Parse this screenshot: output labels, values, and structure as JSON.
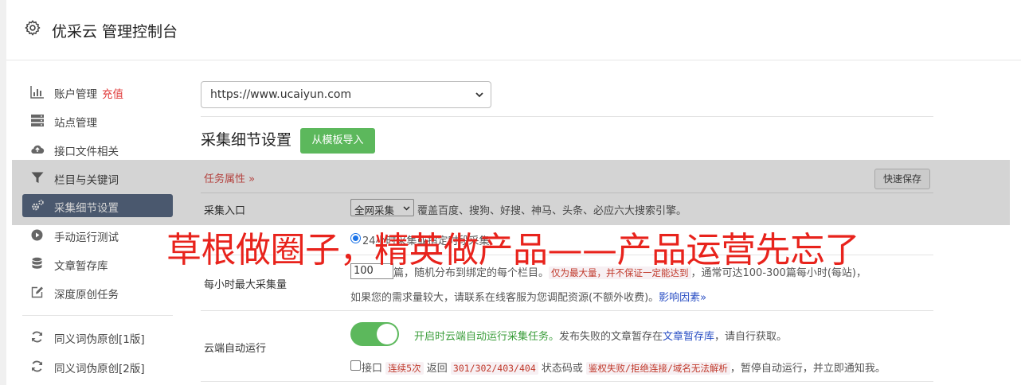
{
  "header": {
    "title": "优采云 管理控制台"
  },
  "sidebar": {
    "items": [
      {
        "label": "账户管理",
        "extra": "充值",
        "icon": "bar-chart-icon"
      },
      {
        "label": "站点管理",
        "icon": "server-icon"
      },
      {
        "label": "接口文件相关",
        "icon": "cloud-upload-icon"
      },
      {
        "label": "栏目与关键词",
        "icon": "filter-icon"
      },
      {
        "label": "采集细节设置",
        "icon": "gears-icon",
        "active": true
      },
      {
        "label": "手动运行测试",
        "icon": "play-circle-icon"
      },
      {
        "label": "文章暂存库",
        "icon": "database-icon"
      },
      {
        "label": "深度原创任务",
        "icon": "edit-icon"
      },
      {
        "label": "同义词伪原创[1版]",
        "icon": "refresh-icon"
      },
      {
        "label": "同义词伪原创[2版]",
        "icon": "refresh-icon"
      }
    ]
  },
  "main": {
    "site_select": "https://www.ucaiyun.com",
    "section_title": "采集细节设置",
    "import_button": "从模板导入",
    "tab_label": "任务属性 »",
    "save_button": "快速保存",
    "rows": {
      "entry": {
        "label": "采集入口",
        "select": "全网采集",
        "desc": "覆盖百度、搜狗、好搜、神马、头条、必应六大搜索引擎。"
      },
      "time": {
        "option": "24小时采集或指定时段采集"
      },
      "max": {
        "label": "每小时最大采集量",
        "value": "100",
        "text1": "篇，随机分布到绑定的每个栏目。",
        "code1": "仅为最大量，并不保证一定能达到",
        "text2": "，通常可达100-300篇每小时(每站)，",
        "text3": "如果您的需求量较大，请联系在线客服为您调配资源(不额外收费)。",
        "link": "影响因素»"
      },
      "cloud": {
        "label": "云端自动运行",
        "desc_green": "开启时云端自动运行采集任务。",
        "desc_1": "发布失败的文章暂存在",
        "desc_link": "文章暂存库",
        "desc_2": "，请自行获取。",
        "chk_1": "接口",
        "chk_code1": "连续5次",
        "chk_2": "返回",
        "chk_code2": "301/302/403/404",
        "chk_3": "状态码或",
        "chk_code3": "鉴权失败/拒绝连接/域名无法解析",
        "chk_4": "，暂停自动运行，并立即通知我。"
      }
    }
  },
  "banner": "草根做圈子，精英做产品——产品运营先忘了",
  "colors": {
    "accent_green": "#5cb85c",
    "sidebar_active": "#5a6a85",
    "banner_red": "#e8231c"
  }
}
